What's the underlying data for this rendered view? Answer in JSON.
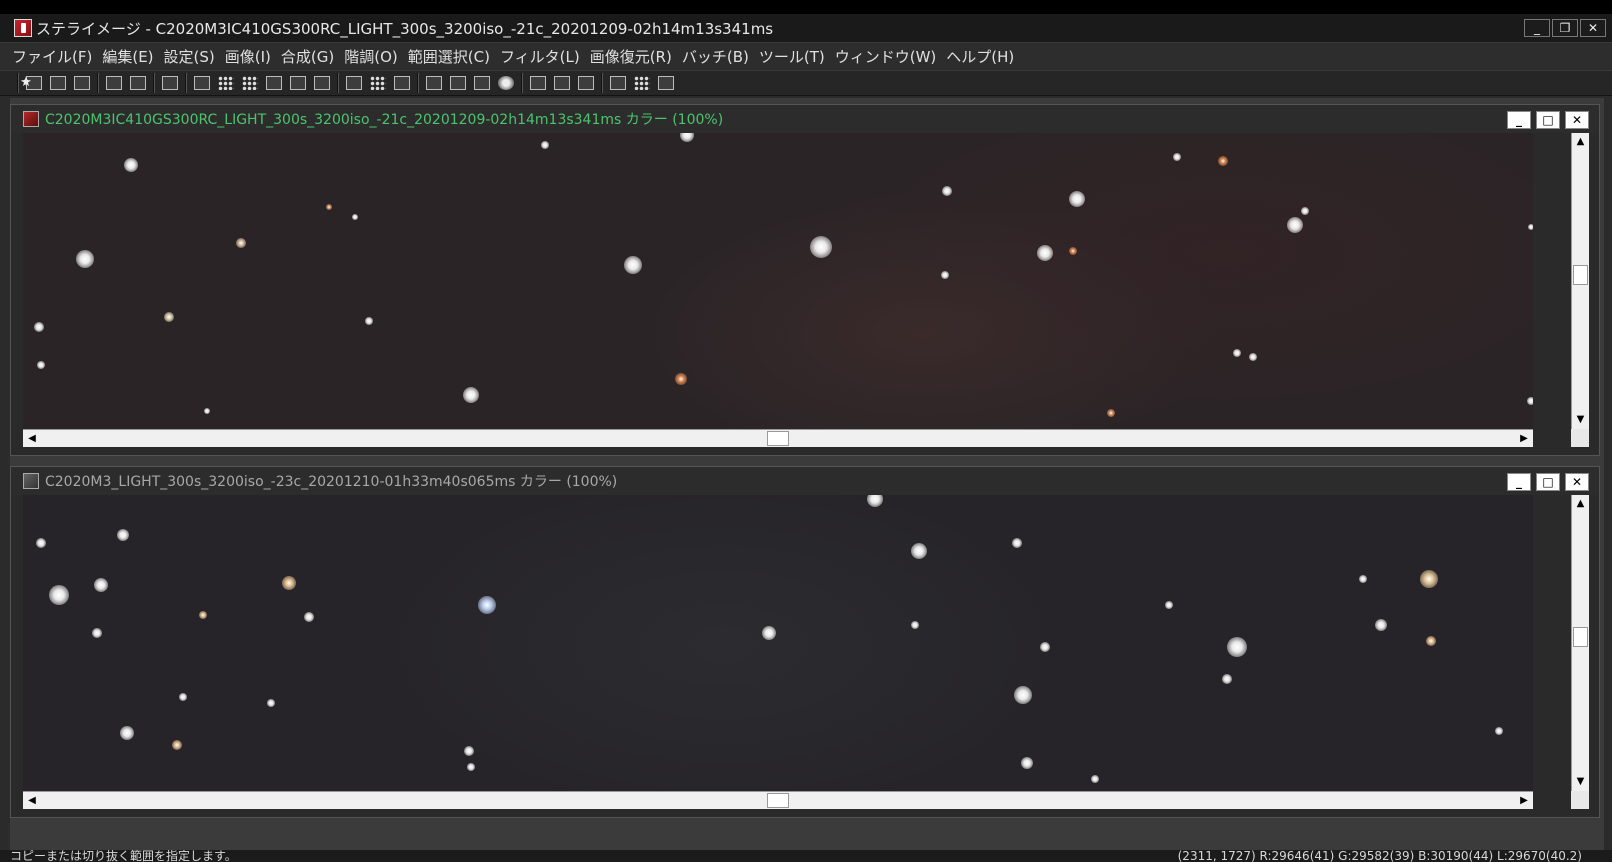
{
  "window": {
    "title": "ステライメージ - C2020M3IC410GS300RC_LIGHT_300s_3200iso_-21c_20201209-02h14m13s341ms",
    "min_label": "_",
    "restore_label": "❐",
    "close_label": "✕"
  },
  "menu": [
    {
      "label": "ファイル(F)"
    },
    {
      "label": "編集(E)"
    },
    {
      "label": "設定(S)"
    },
    {
      "label": "画像(I)"
    },
    {
      "label": "合成(G)"
    },
    {
      "label": "階調(O)"
    },
    {
      "label": "範囲選択(C)"
    },
    {
      "label": "フィルタ(L)"
    },
    {
      "label": "画像復元(R)"
    },
    {
      "label": "バッチ(B)"
    },
    {
      "label": "ツール(T)"
    },
    {
      "label": "ウィンドウ(W)"
    },
    {
      "label": "ヘルプ(H)"
    }
  ],
  "toolbar": {
    "icons": [
      "open-icon",
      "save-icon",
      "print-icon",
      "copy-icon",
      "paste-icon",
      "info-icon",
      "levels-icon",
      "noise-icon",
      "dither-icon",
      "bar-icon",
      "enhance-icon",
      "frame-icon",
      "layers-icon",
      "grid-icon",
      "stack-icon",
      "star-icon",
      "batch-icon",
      "histogram-icon",
      "curves-icon",
      "sphere-icon",
      "zoom-in-icon",
      "zoom-fit-icon",
      "gradient-icon",
      "select-icon",
      "crosshair-icon",
      "target-icon",
      "stars-icon"
    ]
  },
  "child_windows": [
    {
      "title": "C2020M3IC410GS300RC_LIGHT_300s_3200iso_-21c_20201209-02h14m13s341ms カラー (100%)",
      "active": true,
      "title_color": "#4cc46c"
    },
    {
      "title": "C2020M3_LIGHT_300s_3200iso_-23c_20201210-01h33m40s065ms カラー (100%)",
      "active": false,
      "title_color": "#a8a8a8"
    }
  ],
  "child_buttons": {
    "min": "_",
    "max": "□",
    "close": "✕"
  },
  "scroll": {
    "up": "▲",
    "down": "▼",
    "left": "◀",
    "right": "▶"
  },
  "status": {
    "message": "コピーまたは切り抜く範囲を指定します。",
    "readout": "(2311, 1727) R:29646(41) G:29582(39) B:30190(44) L:29670(40.2)"
  }
}
